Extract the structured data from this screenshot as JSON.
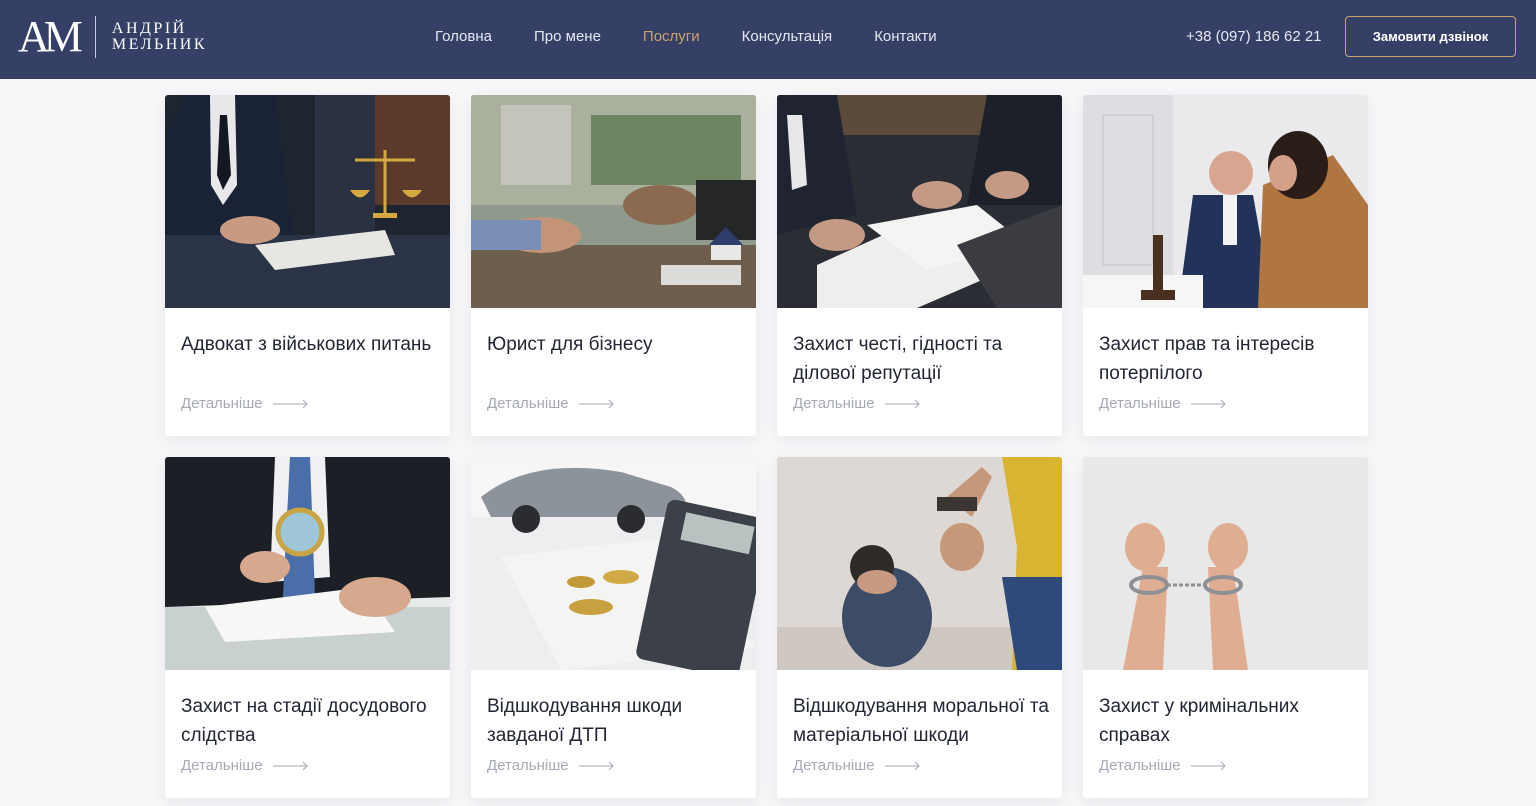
{
  "brand": {
    "mark": "AM",
    "name_line1": "АНДРІЙ",
    "name_line2": "МЕЛЬНИК"
  },
  "nav": {
    "items": [
      {
        "label": "Головна",
        "active": false
      },
      {
        "label": "Про мене",
        "active": false
      },
      {
        "label": "Послуги",
        "active": true
      },
      {
        "label": "Консультація",
        "active": false
      },
      {
        "label": "Контакти",
        "active": false
      }
    ]
  },
  "header": {
    "phone": "+38 (097) 186 62 21",
    "cta_label": "Замовити дзвінок"
  },
  "colors": {
    "header_bg": "#363f66",
    "accent": "#c9a46c"
  },
  "services": [
    {
      "title": "Адвокат з військових питань",
      "more": "Детальніше",
      "image": "lawyer-signing-with-scales"
    },
    {
      "title": "Юрист для бізнесу",
      "more": "Детальніше",
      "image": "business-meeting-house-model"
    },
    {
      "title": "Захист честі, гідності та ділової репутації",
      "more": "Детальніше",
      "image": "documents-and-laptop"
    },
    {
      "title": "Захист прав та інтересів потерпілого",
      "more": "Детальніше",
      "image": "lawyer-with-upset-client"
    },
    {
      "title": "Захист на стадії досудового слідства",
      "more": "Детальніше",
      "image": "magnifying-glass-inspection"
    },
    {
      "title": "Відшкодування шкоди завданої ДТП",
      "more": "Детальніше",
      "image": "car-calculator-coins"
    },
    {
      "title": "Відшкодування моральної та матеріальної шкоди",
      "more": "Детальніше",
      "image": "domestic-violence"
    },
    {
      "title": "Захист у кримінальних справах",
      "more": "Детальніше",
      "image": "handcuffed-hands"
    }
  ]
}
